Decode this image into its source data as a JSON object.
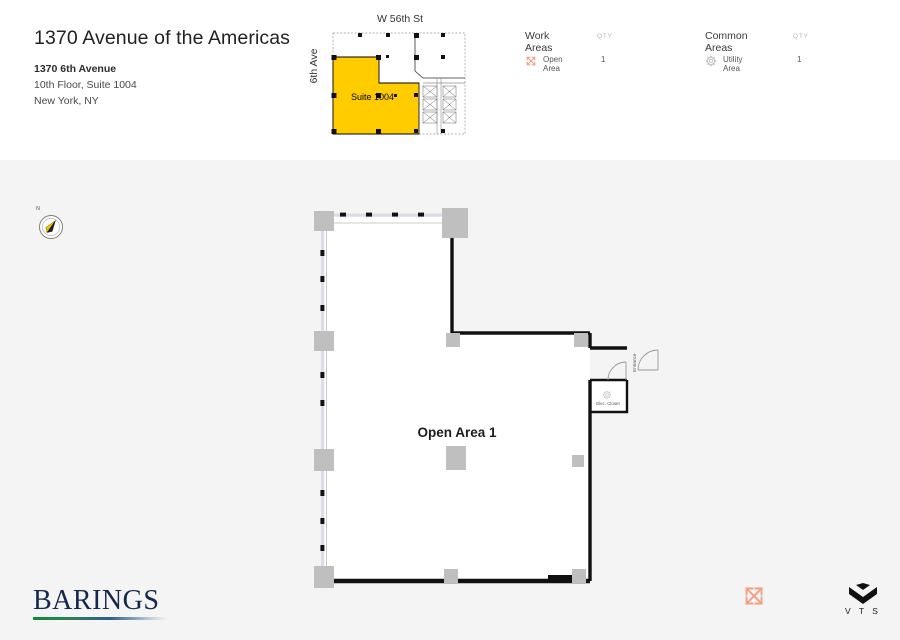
{
  "header": {
    "building_title": "1370 Avenue of the Americas",
    "address_line1": "1370 6th Avenue",
    "address_line2": "10th Floor, Suite 1004",
    "address_line3": "New York, NY"
  },
  "key_plan": {
    "street_label": "W 56th St",
    "avenue_label": "6th Ave",
    "suite_label": "Suite 1004",
    "highlight_color": "#FFCC00"
  },
  "legend": {
    "columns": [
      {
        "title": "Work Areas",
        "qty_header": "QTY",
        "rows": [
          {
            "icon": "expand-arrows-icon",
            "label": "Open Area",
            "qty": "1",
            "color": "#F2A085"
          }
        ]
      },
      {
        "title": "Common Areas",
        "qty_header": "QTY",
        "rows": [
          {
            "icon": "gear-icon",
            "label": "Utility Area",
            "qty": "1",
            "color": "#BFBFBF"
          }
        ]
      }
    ]
  },
  "compass": {
    "north_label": "N",
    "needle_color": "#F2C200"
  },
  "floor_plan": {
    "area_label": "Open Area 1",
    "area_icon": "expand-arrows-icon",
    "area_icon_color": "#F2A085",
    "entrance_label": "Entrance",
    "closet_label": "Elec. Closet",
    "closet_icon": "gear-icon",
    "wall_color": "#111111",
    "column_color": "#BFBFBF",
    "floor_fill": "#FFFFFF"
  },
  "footer": {
    "brand": "BARINGS",
    "vendor": "V T S",
    "vendor_icon": "vts-chevron-logo"
  }
}
